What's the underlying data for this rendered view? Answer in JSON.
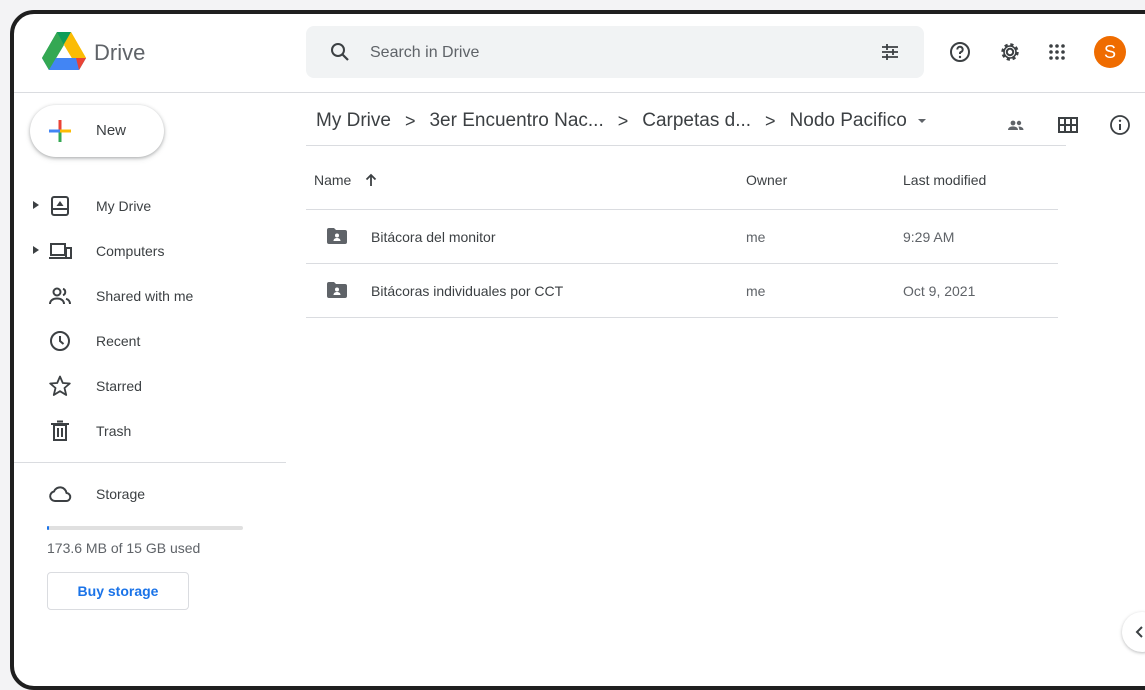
{
  "app": {
    "title": "Drive"
  },
  "search": {
    "placeholder": "Search in Drive"
  },
  "header": {
    "avatar_letter": "S",
    "avatar_color": "#ef6c00"
  },
  "sidebar": {
    "new_label": "New",
    "items": [
      {
        "label": "My Drive",
        "icon": "my-drive-icon"
      },
      {
        "label": "Computers",
        "icon": "computers-icon"
      },
      {
        "label": "Shared with me",
        "icon": "shared-icon"
      },
      {
        "label": "Recent",
        "icon": "clock-icon"
      },
      {
        "label": "Starred",
        "icon": "star-icon"
      },
      {
        "label": "Trash",
        "icon": "trash-icon"
      }
    ],
    "storage": {
      "label": "Storage",
      "used_text": "173.6 MB of 15 GB used",
      "used_fraction": 0.011,
      "buy_label": "Buy storage"
    }
  },
  "breadcrumb": [
    "My Drive",
    "3er Encuentro Nac...",
    "Carpetas d...",
    "Nodo Pacifico"
  ],
  "table": {
    "columns": {
      "name": "Name",
      "owner": "Owner",
      "modified": "Last modified"
    },
    "rows": [
      {
        "name": "Bitácora del monitor",
        "owner": "me",
        "modified": "9:29 AM"
      },
      {
        "name": "Bitácoras individuales por CCT",
        "owner": "me",
        "modified": "Oct 9, 2021"
      }
    ]
  },
  "colors": {
    "accent": "#1a73e8",
    "text": "#3c4043",
    "muted": "#5f6368"
  }
}
